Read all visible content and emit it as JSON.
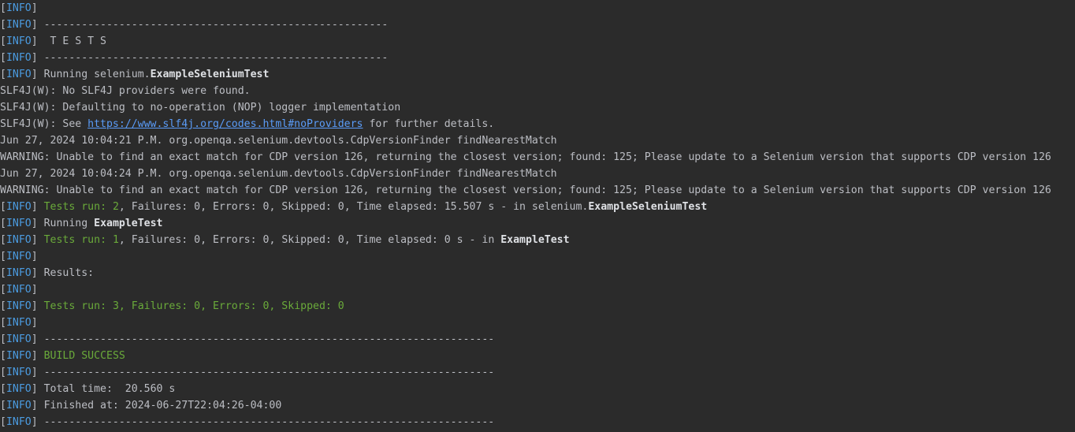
{
  "console": {
    "lines": [
      [
        {
          "t": "[",
          "c": "plain"
        },
        {
          "t": "INFO",
          "c": "info"
        },
        {
          "t": "]",
          "c": "plain"
        }
      ],
      [
        {
          "t": "[",
          "c": "plain"
        },
        {
          "t": "INFO",
          "c": "info"
        },
        {
          "t": "] -------------------------------------------------------",
          "c": "plain"
        }
      ],
      [
        {
          "t": "[",
          "c": "plain"
        },
        {
          "t": "INFO",
          "c": "info"
        },
        {
          "t": "]  T E S T S",
          "c": "plain"
        }
      ],
      [
        {
          "t": "[",
          "c": "plain"
        },
        {
          "t": "INFO",
          "c": "info"
        },
        {
          "t": "] -------------------------------------------------------",
          "c": "plain"
        }
      ],
      [
        {
          "t": "[",
          "c": "plain"
        },
        {
          "t": "INFO",
          "c": "info"
        },
        {
          "t": "] Running selenium.",
          "c": "plain"
        },
        {
          "t": "ExampleSeleniumTest",
          "c": "bold"
        }
      ],
      [
        {
          "t": "SLF4J(W): No SLF4J providers were found.",
          "c": "plain"
        }
      ],
      [
        {
          "t": "SLF4J(W): Defaulting to no-operation (NOP) logger implementation",
          "c": "plain"
        }
      ],
      [
        {
          "t": "SLF4J(W): See ",
          "c": "plain"
        },
        {
          "t": "https://www.slf4j.org/codes.html#noProviders",
          "c": "link"
        },
        {
          "t": " for further details.",
          "c": "plain"
        }
      ],
      [
        {
          "t": "Jun 27, 2024 10:04:21 P.M. org.openqa.selenium.devtools.CdpVersionFinder findNearestMatch",
          "c": "plain"
        }
      ],
      [
        {
          "t": "WARNING: Unable to find an exact match for CDP version 126, returning the closest version; found: 125; Please update to a Selenium version that supports CDP version 126",
          "c": "plain"
        }
      ],
      [
        {
          "t": "Jun 27, 2024 10:04:24 P.M. org.openqa.selenium.devtools.CdpVersionFinder findNearestMatch",
          "c": "plain"
        }
      ],
      [
        {
          "t": "WARNING: Unable to find an exact match for CDP version 126, returning the closest version; found: 125; Please update to a Selenium version that supports CDP version 126",
          "c": "plain"
        }
      ],
      [
        {
          "t": "[",
          "c": "plain"
        },
        {
          "t": "INFO",
          "c": "info"
        },
        {
          "t": "] ",
          "c": "plain"
        },
        {
          "t": "Tests run: 2",
          "c": "green"
        },
        {
          "t": ", Failures: 0, Errors: 0, Skipped: 0, Time elapsed: 15.507 s - in selenium.",
          "c": "plain"
        },
        {
          "t": "ExampleSeleniumTest",
          "c": "bold"
        }
      ],
      [
        {
          "t": "[",
          "c": "plain"
        },
        {
          "t": "INFO",
          "c": "info"
        },
        {
          "t": "] Running ",
          "c": "plain"
        },
        {
          "t": "ExampleTest",
          "c": "bold"
        }
      ],
      [
        {
          "t": "[",
          "c": "plain"
        },
        {
          "t": "INFO",
          "c": "info"
        },
        {
          "t": "] ",
          "c": "plain"
        },
        {
          "t": "Tests run: 1",
          "c": "green"
        },
        {
          "t": ", Failures: 0, Errors: 0, Skipped: 0, Time elapsed: 0 s - in ",
          "c": "plain"
        },
        {
          "t": "ExampleTest",
          "c": "bold"
        }
      ],
      [
        {
          "t": "[",
          "c": "plain"
        },
        {
          "t": "INFO",
          "c": "info"
        },
        {
          "t": "]",
          "c": "plain"
        }
      ],
      [
        {
          "t": "[",
          "c": "plain"
        },
        {
          "t": "INFO",
          "c": "info"
        },
        {
          "t": "] Results:",
          "c": "plain"
        }
      ],
      [
        {
          "t": "[",
          "c": "plain"
        },
        {
          "t": "INFO",
          "c": "info"
        },
        {
          "t": "]",
          "c": "plain"
        }
      ],
      [
        {
          "t": "[",
          "c": "plain"
        },
        {
          "t": "INFO",
          "c": "info"
        },
        {
          "t": "] ",
          "c": "plain"
        },
        {
          "t": "Tests run: 3, Failures: 0, Errors: 0, Skipped: 0",
          "c": "green"
        }
      ],
      [
        {
          "t": "[",
          "c": "plain"
        },
        {
          "t": "INFO",
          "c": "info"
        },
        {
          "t": "]",
          "c": "plain"
        }
      ],
      [
        {
          "t": "[",
          "c": "plain"
        },
        {
          "t": "INFO",
          "c": "info"
        },
        {
          "t": "] ------------------------------------------------------------------------",
          "c": "plain"
        }
      ],
      [
        {
          "t": "[",
          "c": "plain"
        },
        {
          "t": "INFO",
          "c": "info"
        },
        {
          "t": "] ",
          "c": "plain"
        },
        {
          "t": "BUILD SUCCESS",
          "c": "green"
        }
      ],
      [
        {
          "t": "[",
          "c": "plain"
        },
        {
          "t": "INFO",
          "c": "info"
        },
        {
          "t": "] ------------------------------------------------------------------------",
          "c": "plain"
        }
      ],
      [
        {
          "t": "[",
          "c": "plain"
        },
        {
          "t": "INFO",
          "c": "info"
        },
        {
          "t": "] Total time:  20.560 s",
          "c": "plain"
        }
      ],
      [
        {
          "t": "[",
          "c": "plain"
        },
        {
          "t": "INFO",
          "c": "info"
        },
        {
          "t": "] Finished at: 2024-06-27T22:04:26-04:00",
          "c": "plain"
        }
      ],
      [
        {
          "t": "[",
          "c": "plain"
        },
        {
          "t": "INFO",
          "c": "info"
        },
        {
          "t": "] ------------------------------------------------------------------------",
          "c": "plain"
        }
      ]
    ]
  },
  "colors": {
    "background": "#2b2b2b",
    "text": "#bcbec4",
    "info_tag": "#4b9be0",
    "success": "#6aaa3a",
    "link": "#5a9cf8"
  }
}
